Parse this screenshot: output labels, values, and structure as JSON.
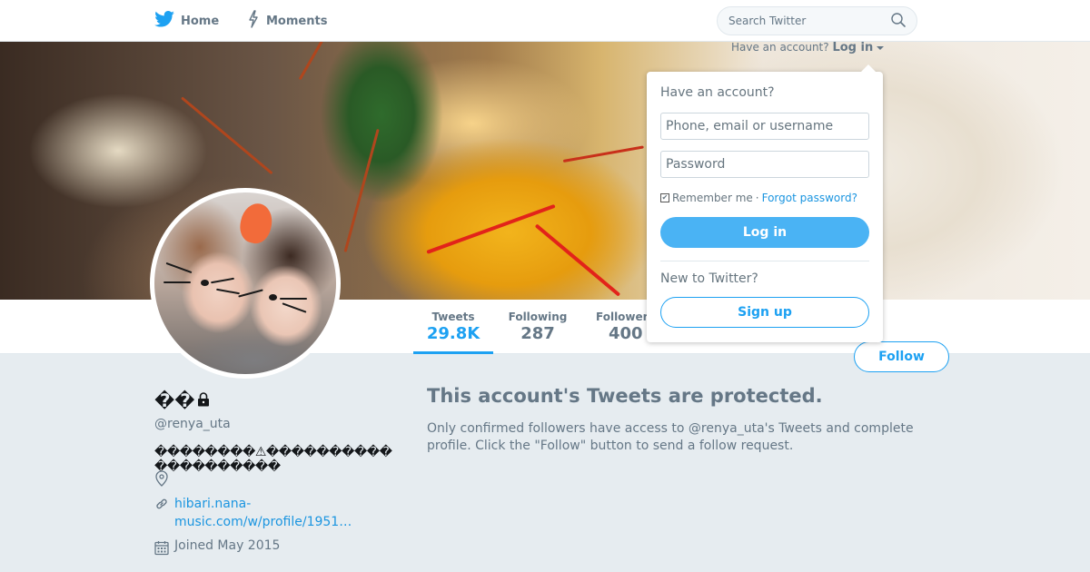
{
  "nav": {
    "home_label": "Home",
    "moments_label": "Moments",
    "search_placeholder": "Search Twitter"
  },
  "login_strip": {
    "prompt": "Have an account?",
    "login_label": "Log in"
  },
  "login_dropdown": {
    "heading": "Have an account?",
    "username_placeholder": "Phone, email or username",
    "password_placeholder": "Password",
    "remember_label": "Remember me",
    "separator": "·",
    "forgot_label": "Forgot password?",
    "login_button": "Log in",
    "new_prompt": "New to Twitter?",
    "signup_button": "Sign up"
  },
  "stats": [
    {
      "label": "Tweets",
      "value": "29.8K"
    },
    {
      "label": "Following",
      "value": "287"
    },
    {
      "label": "Followers",
      "value": "400"
    }
  ],
  "follow_button": "Follow",
  "profile": {
    "name": "��",
    "handle": "@renya_uta",
    "bio": "��������⚠���������� ����������",
    "website_line1": "hibari.nana-",
    "website_line2": "music.com/w/profile/1951…",
    "joined": "Joined May 2015"
  },
  "protected": {
    "title": "This account's Tweets are protected.",
    "message": "Only confirmed followers have access to @renya_uta's Tweets and complete profile. Click the \"Follow\" button to send a follow request."
  },
  "colors": {
    "accent": "#1da1f2",
    "background": "#e6ecf0",
    "secondary_text": "#657786"
  },
  "icons": [
    "twitter-bird-icon",
    "moments-bolt-icon",
    "search-icon",
    "caret-down-icon",
    "lock-icon",
    "location-icon",
    "link-icon",
    "calendar-icon"
  ]
}
